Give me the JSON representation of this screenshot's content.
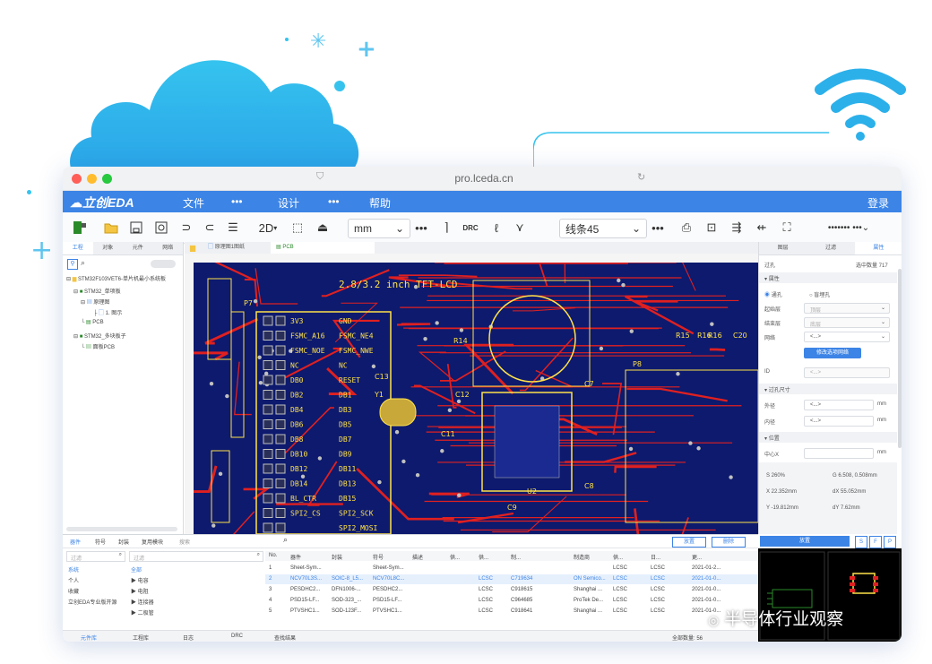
{
  "browser": {
    "url": "pro.lceda.cn"
  },
  "menubar": {
    "logo": "立创EDA",
    "items": [
      "文件",
      "•••",
      "设计",
      "•••",
      "帮助"
    ],
    "login": "登录"
  },
  "toolbar": {
    "view_mode": "2D",
    "unit": "mm",
    "routing_mode": "线条45",
    "more": "••••••• ••• "
  },
  "left_panel": {
    "tabs": [
      "工程",
      "对象",
      "元件",
      "网络"
    ],
    "tree": [
      "STM32F103VET6-单片机最小系统板",
      "STM32_单项板",
      "原理图",
      "1. 图示",
      "PCB",
      "STM32_多块板子",
      "面板PCB"
    ]
  },
  "doc_tabs": [
    "原理图1图纸",
    "PCB"
  ],
  "pcb": {
    "silk_title": "2.8/3.2 inch TFT-LCD",
    "pins_left": [
      "3V3",
      "FSMC_A16",
      "FSMC_NOE",
      "NC",
      "DB0",
      "DB2",
      "DB4",
      "DB6",
      "DB8",
      "DB10",
      "DB12",
      "DB14",
      "BL_CTR",
      "SPI2_CS"
    ],
    "pins_right": [
      "GND",
      "FSMC_NE4",
      "FSMC_NWE",
      "NC",
      "RESET",
      "DB1",
      "DB3",
      "DB5",
      "DB7",
      "DB9",
      "DB11",
      "DB13",
      "DB15",
      "SPI2_SCK",
      "SPI2_MOSI"
    ],
    "labels": [
      "P7",
      "P8",
      "U2",
      "C8",
      "C7",
      "Y1",
      "C11",
      "C12",
      "C13",
      "R15",
      "R16",
      "C20",
      "R14",
      "R16",
      "C9"
    ]
  },
  "right_panel": {
    "tabs": [
      "图层",
      "过滤",
      "属性"
    ],
    "header_left": "过孔",
    "header_right": "选中数量 717",
    "section_props": "属性",
    "radio_1": "通孔",
    "radio_2": "盲埋孔",
    "field_start_layer": "起始层",
    "field_end_layer": "结束层",
    "field_net": "网络",
    "start_value": "顶层",
    "end_value": "底层",
    "net_value": "<...>",
    "button": "修改选项网络",
    "id_label": "ID",
    "id_value": "<...>",
    "section_size": "过孔尺寸",
    "outer_label": "外径",
    "inner_label": "内径",
    "outer_value": "<...>",
    "inner_value": "<...>",
    "unit": "mm",
    "section_pos": "位置",
    "center_x": "中心X",
    "coords": {
      "s": "S  260%",
      "g": "G  6.508, 0.508mm",
      "x": "X  22.352mm",
      "dx": "dX  55.052mm",
      "y": "Y  -19.812mm",
      "dy": "dY  7.62mm"
    }
  },
  "bottom": {
    "tabs": [
      "器件",
      "符号",
      "封装",
      "复用模块",
      "搜索"
    ],
    "filter_placeholder": "过滤",
    "categories": [
      "系统",
      "个人",
      "收藏",
      "立创EDA专业版开源"
    ],
    "sub_categories": [
      "全部",
      "▶ 电容",
      "▶ 电阻",
      "▶ 连接器",
      "▶ 二极管"
    ],
    "buttons": [
      "放置",
      "删除"
    ],
    "columns": [
      "No.",
      "器件",
      "封装",
      "符号",
      "描述",
      "供...",
      "供...",
      "制...",
      "制造商",
      "供...",
      "日...",
      "更..."
    ],
    "rows": [
      [
        "1",
        "Sheet-Sym...",
        "",
        "Sheet-Sym...",
        "",
        "",
        "",
        "",
        "LCSC",
        "LCSC",
        "2021-01-2..."
      ],
      [
        "2",
        "NCV70L3S...",
        "SOIC-8_L5...",
        "NCV70L8C...",
        "",
        "LCSC",
        "C719634",
        "ON Semico...",
        "LCSC",
        "LCSC",
        "2021-01-0..."
      ],
      [
        "3",
        "PESDHC2...",
        "DFN1006-...",
        "PESDHC2...",
        "",
        "LCSC",
        "C918615",
        "Shanghai ...",
        "LCSC",
        "LCSC",
        "2021-01-0..."
      ],
      [
        "4",
        "PSD15-LF...",
        "SOD-323_...",
        "PSD15-LF...",
        "",
        "LCSC",
        "C964685",
        "ProTek De...",
        "LCSC",
        "LCSC",
        "2021-01-0..."
      ],
      [
        "5",
        "PTVSHC1...",
        "SOD-123F...",
        "PTVSHC1...",
        "",
        "LCSC",
        "C918641",
        "Shanghai ...",
        "LCSC",
        "LCSC",
        "2021-01-0..."
      ]
    ],
    "status_tabs": [
      "元件库",
      "工程库",
      "日志",
      "DRC",
      "查找结果"
    ],
    "count_label": "全部数量: 56",
    "preview_button": "放置",
    "preview_tabs": [
      "S",
      "F",
      "P"
    ]
  },
  "watermark": "半导体行业观察",
  "colors": {
    "accent": "#3c84e6",
    "pcb_bg": "#0d1a6e",
    "trace": "#e02020",
    "silk": "#ffe24a",
    "pad": "#c0c0c0"
  }
}
